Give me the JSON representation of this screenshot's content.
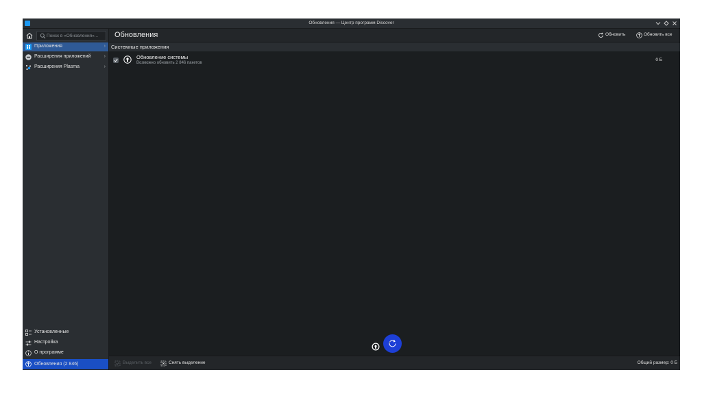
{
  "window": {
    "title": "Обновления — Центр программ Discover"
  },
  "search": {
    "placeholder": "Поиск в «Обновления»..."
  },
  "sidebar": {
    "items": [
      {
        "label": "Приложения"
      },
      {
        "label": "Расширения приложений"
      },
      {
        "label": "Расширения Plasma"
      }
    ],
    "bottom": [
      {
        "label": "Установленные"
      },
      {
        "label": "Настройка"
      },
      {
        "label": "О программе"
      },
      {
        "label": "Обновления (2 846)"
      }
    ]
  },
  "header": {
    "title": "Обновления",
    "refresh_label": "Обновить",
    "update_all_label": "Обновить все"
  },
  "section": {
    "title": "Системные приложения"
  },
  "updates": [
    {
      "name": "Обновление системы",
      "description": "Возможно обновить 2 846 пакетов",
      "size": "0 Б"
    }
  ],
  "footer": {
    "select_all_label": "Выделить все",
    "deselect_label": "Снять выделение",
    "total_size": "Общий размер: 0 Б"
  },
  "colors": {
    "accent": "#1d99f3",
    "selected": "#1a4fc4",
    "fab": "#1d3fd6"
  }
}
